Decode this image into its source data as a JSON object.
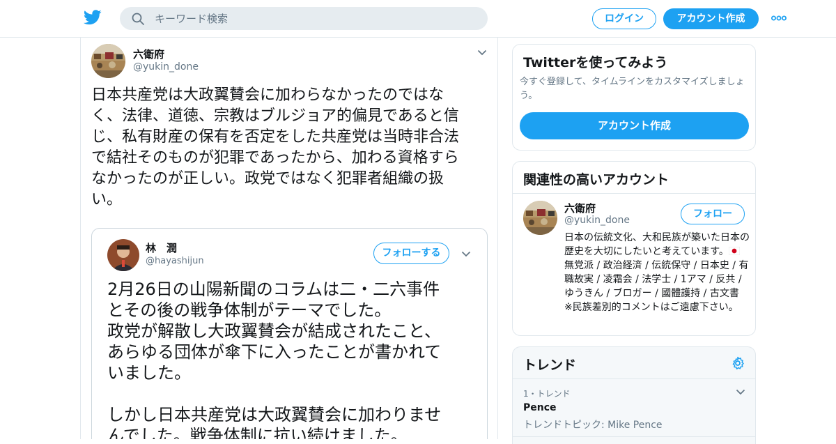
{
  "header": {
    "search_placeholder": "キーワード検索",
    "login_label": "ログイン",
    "signup_label": "アカウント作成"
  },
  "tweet": {
    "author_name": "六衛府",
    "author_handle": "@yukin_done",
    "text": "日本共産党は大政翼賛会に加わらなかったのではな\nく、法律、道徳、宗教はブルジョア的偏見であると信\nじ、私有財産の保有を否定をした共産党は当時非合法\nで結社そのものが犯罪であったから、加わる資格すら\nなかったのが正しい。政党ではなく犯罪者組織の扱\nい。",
    "quoted_image": {
      "name": "林　潤",
      "handle": "@hayashijun",
      "follow_label": "フォローする",
      "text": "2月26日の山陽新聞のコラムは二・二六事件\nとその後の戦争体制がテーマでした。\n政党が解散し大政翼賛会が結成されたこと、\nあらゆる団体が傘下に入ったことが書かれて\nいました。\n\nしかし日本共産党は大政翼賛会に加わりませ\nんでした。戦争体制に抗い続けました。"
    }
  },
  "sidebar": {
    "signup_card": {
      "title": "Twitterを使ってみよう",
      "subtitle": "今すぐ登録して、タイムラインをカスタマイズしましょう。",
      "button_label": "アカウント作成"
    },
    "related_card": {
      "title": "関連性の高いアカウント",
      "name": "六衛府",
      "handle": "@yukin_done",
      "follow_label": "フォロー",
      "bio_before_flag": "日本の伝統文化、大和民族が築いた日本の歴史を大切にしたいと考えています。",
      "bio_after_flag": " 無党派 / 政治経済 / 伝統保守 / 日本史 / 有職故実 / 凌霜会 / 法学士 / 1アマ / 反共 / ゆうきん / ブロガー / 國體護持 / 古文書 ※民族差別的コメントはご遠慮下さい。"
    },
    "trends_card": {
      "title": "トレンド",
      "items": [
        {
          "rank_label": "1・トレンド",
          "name": "Pence",
          "topic": "トレンドトピック: Mike Pence"
        }
      ]
    }
  },
  "colors": {
    "accent": "#1da1f2",
    "muted": "#657786",
    "border": "#e1e8ed"
  }
}
